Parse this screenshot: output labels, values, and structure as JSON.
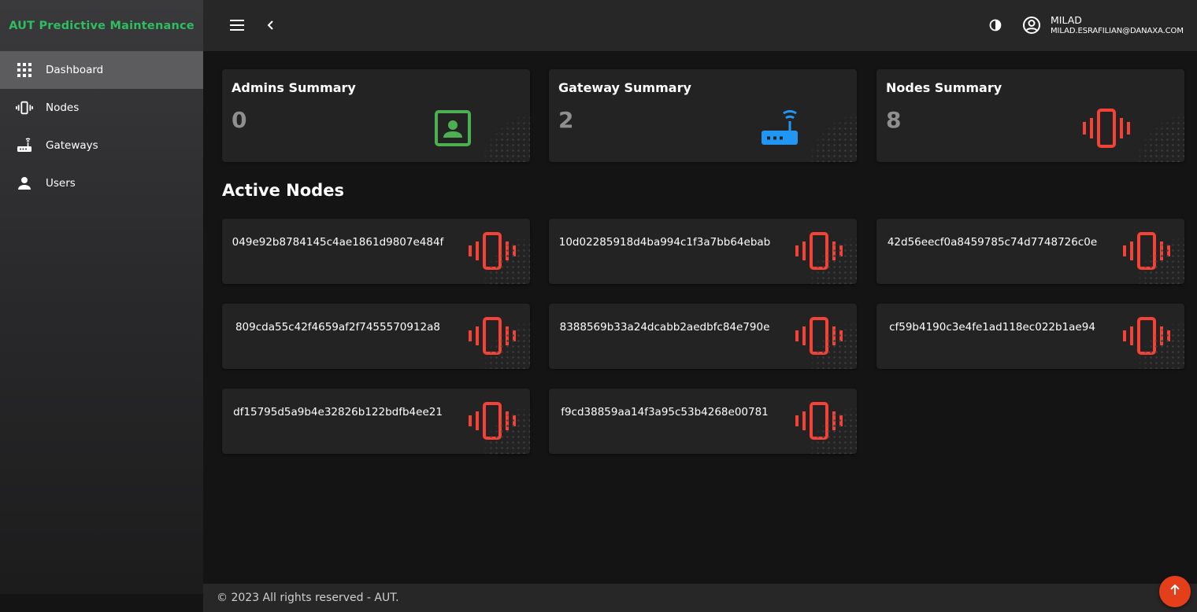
{
  "app": {
    "brand": "AUT Predictive Maintenance"
  },
  "sidebar": {
    "items": [
      {
        "label": "Dashboard",
        "icon": "grid-icon",
        "active": true
      },
      {
        "label": "Nodes",
        "icon": "vibration-icon"
      },
      {
        "label": "Gateways",
        "icon": "router-icon"
      },
      {
        "label": "Users",
        "icon": "person-icon"
      }
    ]
  },
  "header": {
    "user_name": "MILAD",
    "user_email": "MILAD.ESRAFILIAN@DANAXA.COM"
  },
  "summary": [
    {
      "title": "Admins Summary",
      "value": "0",
      "icon": "contact-card-icon",
      "color": "#4caf50"
    },
    {
      "title": "Gateway Summary",
      "value": "2",
      "icon": "router-icon",
      "color": "#2196f3"
    },
    {
      "title": "Nodes Summary",
      "value": "8",
      "icon": "vibration-icon",
      "color": "#f44336"
    }
  ],
  "active_nodes": {
    "title": "Active Nodes",
    "items": [
      "049e92b8784145c4ae1861d9807e484f",
      "10d02285918d4ba994c1f3a7bb64ebab",
      "42d56eecf0a8459785c74d7748726c0e",
      "809cda55c42f4659af2f7455570912a8",
      "8388569b33a24dcabb2aedbfc84e790e",
      "cf59b4190c3e4fe1ad118ec022b1ae94",
      "df15795d5a9b4e32826b122bdfb4ee21",
      "f9cd38859aa14f3a95c53b4268e00781"
    ]
  },
  "footer": {
    "text": "© 2023 All rights reserved - AUT."
  },
  "colors": {
    "brand": "#2ebd5f",
    "node_icon": "#f44336",
    "scroll_top": "#e53e1a"
  }
}
